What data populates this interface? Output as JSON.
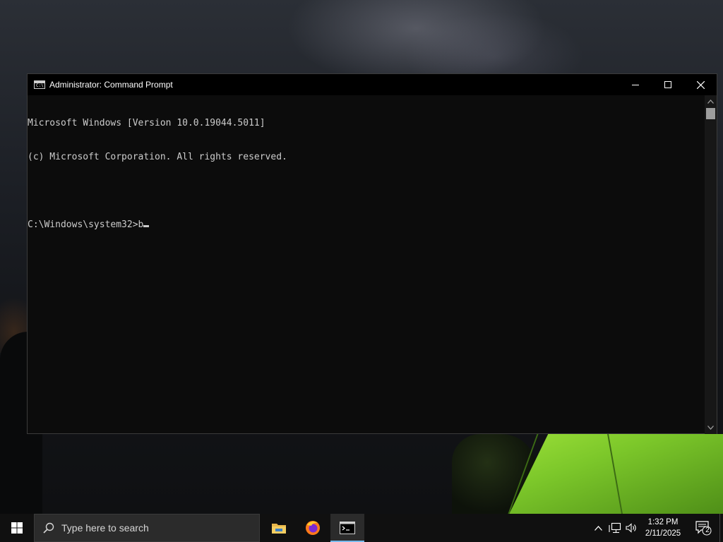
{
  "window": {
    "title": "Administrator: Command Prompt",
    "app_icon_glyph": "C:\\",
    "controls": [
      "minimize",
      "maximize",
      "close"
    ]
  },
  "console": {
    "lines": [
      "Microsoft Windows [Version 10.0.19044.5011]",
      "(c) Microsoft Corporation. All rights reserved.",
      "",
      "C:\\Windows\\system32>b"
    ],
    "text_color": "#cccccc",
    "background": "#0c0c0c"
  },
  "taskbar": {
    "search_placeholder": "Type here to search",
    "apps": [
      {
        "name": "file-explorer",
        "active": false
      },
      {
        "name": "firefox",
        "active": false
      },
      {
        "name": "command-prompt",
        "active": true
      }
    ],
    "tray": {
      "time": "1:32 PM",
      "date": "2/11/2025",
      "notification_count": "2"
    },
    "accent": "#76b9ed"
  }
}
